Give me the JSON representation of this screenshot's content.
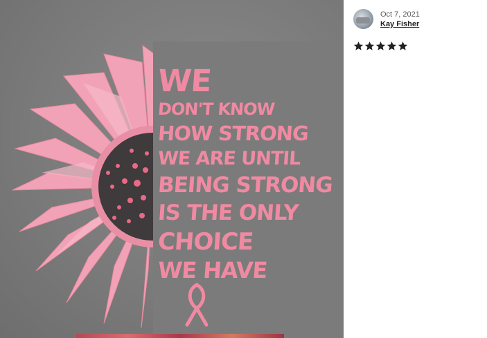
{
  "photo": {
    "shirt_lines": [
      "We",
      "Don't know",
      "how strong",
      "we are until",
      "being strong",
      "is the only",
      "choice",
      "we have"
    ],
    "colors": {
      "shirt": "#7b7b7b",
      "print_pink": "#f08aa2"
    }
  },
  "review": {
    "date": "Oct 7, 2021",
    "reviewer_name": "Kay Fisher",
    "rating": 5,
    "star_icon": "star-icon",
    "star_color": "#222222"
  }
}
